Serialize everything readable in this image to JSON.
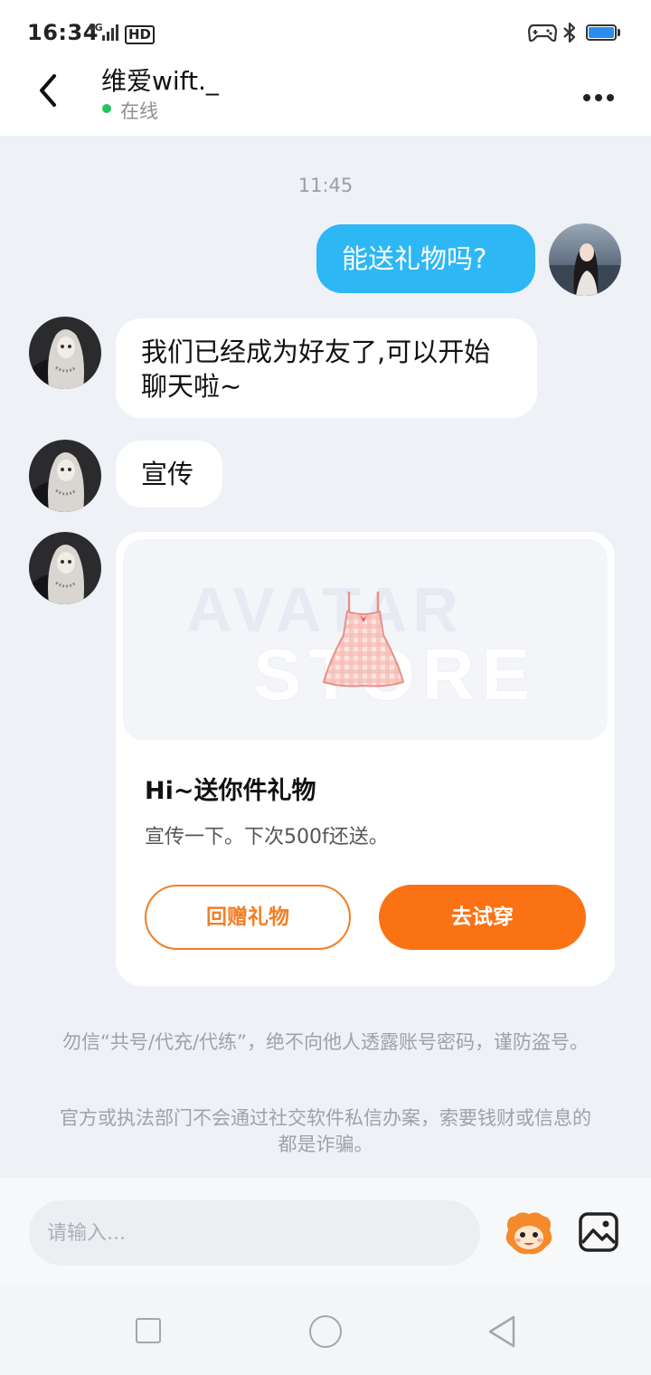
{
  "status_bar": {
    "time": "16:34",
    "network": "4G",
    "hd": "HD",
    "icons": [
      "signal-icon",
      "game-controller-icon",
      "bluetooth-icon",
      "battery-icon"
    ],
    "battery_color": "#2d8cf0"
  },
  "header": {
    "title": "维爱wift._",
    "status": "在线",
    "status_color": "#22c55e",
    "back_icon": "chevron-left-icon",
    "more_icon": "more-dots-icon"
  },
  "messages": {
    "timestamp": "11:45",
    "outgoing": {
      "text": "能送礼物吗?",
      "color": "#2db7f5"
    },
    "incoming": [
      {
        "text": "我们已经成为好友了,可以开始聊天啦~"
      },
      {
        "text": "宣传"
      }
    ],
    "gift_card": {
      "watermark_line1": "AVATAR",
      "watermark_line2": "STORE",
      "title": "Hi~送你件礼物",
      "description": "宣传一下。下次500f还送。",
      "return_gift_label": "回赠礼物",
      "try_on_label": "去试穿",
      "accent_color": "#fb7214"
    }
  },
  "notices": [
    "勿信“共号/代充/代练”，绝不向他人透露账号密码，谨防盗号。",
    "官方或执法部门不会通过社交软件私信办案，索要钱财或信息的都是诈骗。"
  ],
  "composer": {
    "placeholder": "请输入...",
    "emoji_icon": "emoji-mascot-icon",
    "image_icon": "image-icon"
  },
  "nav_bar": {
    "icons": [
      "recent-apps-icon",
      "home-icon",
      "back-triangle-icon"
    ]
  }
}
